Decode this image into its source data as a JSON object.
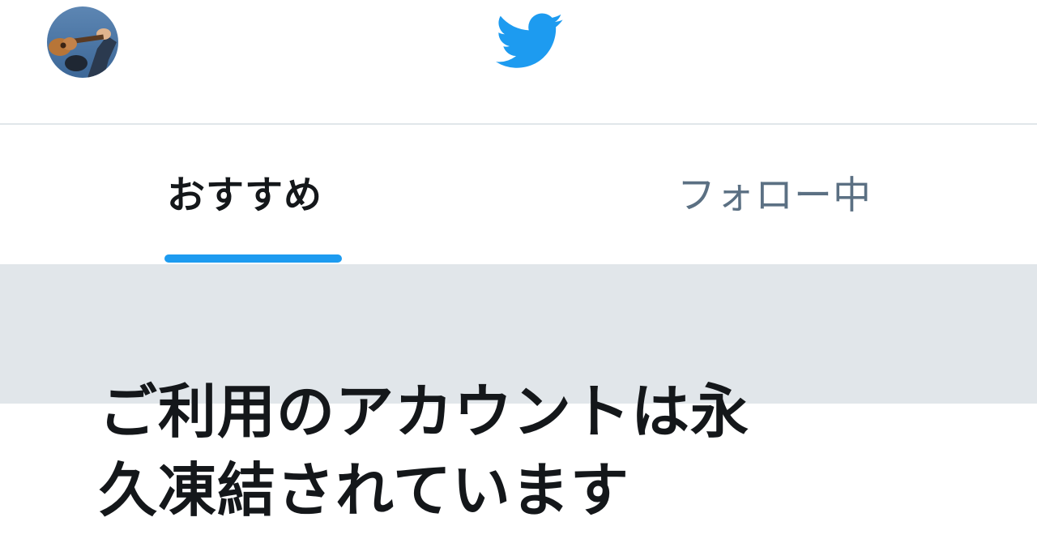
{
  "header": {
    "avatar_icon": "profile-avatar-ukulele",
    "logo_icon": "twitter-bird-icon",
    "logo_color": "#1d9bf0"
  },
  "tabs": [
    {
      "label": "おすすめ",
      "active": true
    },
    {
      "label": "フォロー中",
      "active": false
    }
  ],
  "tab_indicator_color": "#1d9bf0",
  "notice": {
    "line1": "ご利用のアカウントは永",
    "line2": "久凍結されています"
  }
}
